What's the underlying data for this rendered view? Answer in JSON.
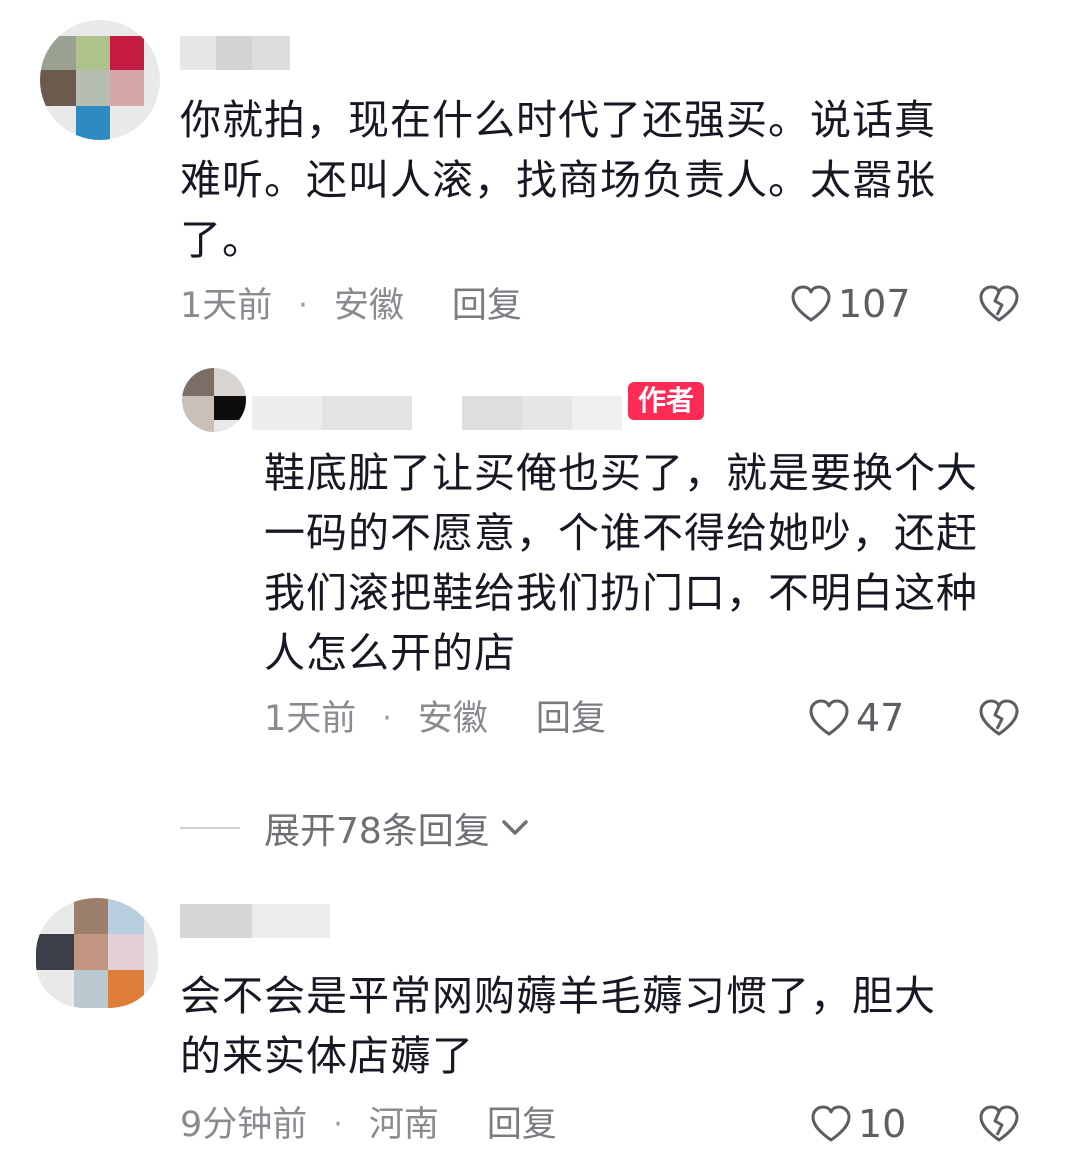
{
  "comments": [
    {
      "text": "你就拍，现在什么时代了还强买。说话真\n难听。还叫人滚，找商场负责人。太嚣张\n了。",
      "time": "1天前",
      "location": "安徽",
      "reply_label": "回复",
      "likes": "107"
    },
    {
      "badge": "作者",
      "text": "鞋底脏了让买俺也买了，就是要换个大\n一码的不愿意，个谁不得给她吵，还赶\n我们滚把鞋给我们扔门口，不明白这种\n人怎么开的店",
      "time": "1天前",
      "location": "安徽",
      "reply_label": "回复",
      "likes": "47"
    },
    {
      "text": "会不会是平常网购薅羊毛薅习惯了，胆大\n的来实体店薅了",
      "time": "9分钟前",
      "location": "河南",
      "reply_label": "回复",
      "likes": "10"
    }
  ],
  "expand_replies": "展开78条回复",
  "icons": {
    "like": "heart-outline-icon",
    "dislike": "broken-heart-icon",
    "expand": "chevron-down-icon"
  },
  "colors": {
    "accent": "#fe2c55",
    "text": "#161823",
    "meta": "#8a8b91"
  }
}
